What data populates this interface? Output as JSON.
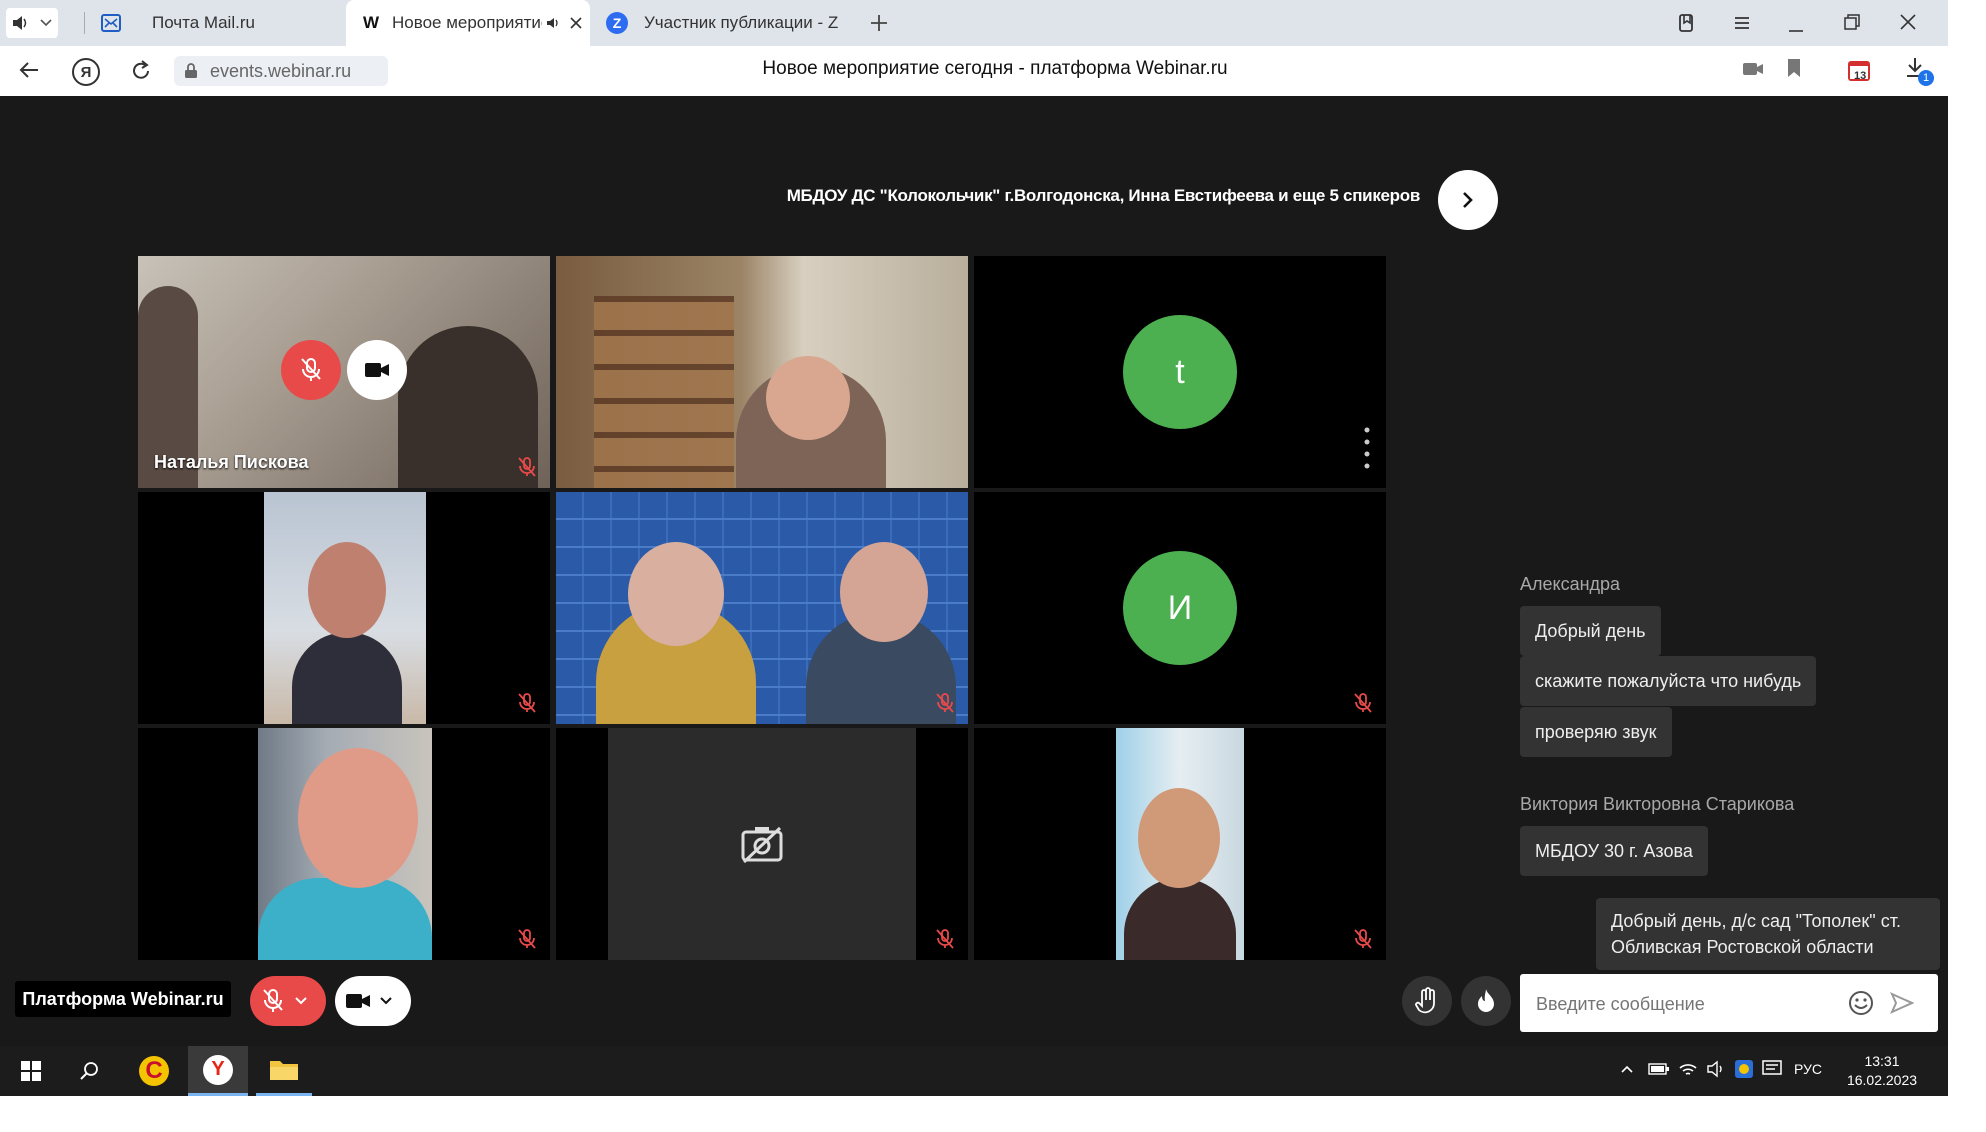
{
  "browser": {
    "tabs": [
      {
        "title": "Почта Mail.ru",
        "icon": "mail-icon",
        "active": false
      },
      {
        "title": "Новое мероприятие",
        "icon": "webinar-w-icon",
        "active": true
      },
      {
        "title": "Участник публикации - Zo",
        "icon": "zoom-z-icon",
        "active": false
      }
    ],
    "url": "events.webinar.ru",
    "page_title": "Новое мероприятие сегодня - платформа Webinar.ru",
    "downloads_badge": "1",
    "calendar_badge": "13"
  },
  "event": {
    "speakers_line": "МБДОУ ДС \"Колокольчик\" г.Волгодонска, Инна Евстифеева и еще 5 спикеров"
  },
  "tiles": [
    {
      "name": "Наталья Пискова",
      "kind": "video",
      "muted": true
    },
    {
      "name": "",
      "kind": "video",
      "muted": false
    },
    {
      "name": "",
      "kind": "avatar",
      "initial": "t",
      "muted": false
    },
    {
      "name": "",
      "kind": "video",
      "muted": true
    },
    {
      "name": "",
      "kind": "video",
      "muted": true
    },
    {
      "name": "",
      "kind": "avatar",
      "initial": "И",
      "muted": true
    },
    {
      "name": "",
      "kind": "video",
      "muted": true
    },
    {
      "name": "",
      "kind": "camera-off",
      "muted": true
    },
    {
      "name": "",
      "kind": "video",
      "muted": true
    }
  ],
  "chat": {
    "author1": "Александра",
    "messages1": [
      "Добрый день",
      "скажите пожалуйста что нибудь",
      "проверяю звук"
    ],
    "author2": "Виктория Викторовна Старикова",
    "messages2": [
      "МБДОУ 30 г. Азова"
    ],
    "own_line1": "Добрый день, д/с сад \"Тополек\" ст.",
    "own_line2": "Обливская Ростовской области",
    "input_placeholder": "Введите сообщение"
  },
  "footer": {
    "platform_label": "Платформа Webinar.ru"
  },
  "taskbar": {
    "time": "13:31",
    "date": "16.02.2023",
    "lang": "РУС"
  },
  "colors": {
    "accent_red": "#e84a4a",
    "avatar_green": "#4caf50",
    "page_bg": "#191919"
  }
}
